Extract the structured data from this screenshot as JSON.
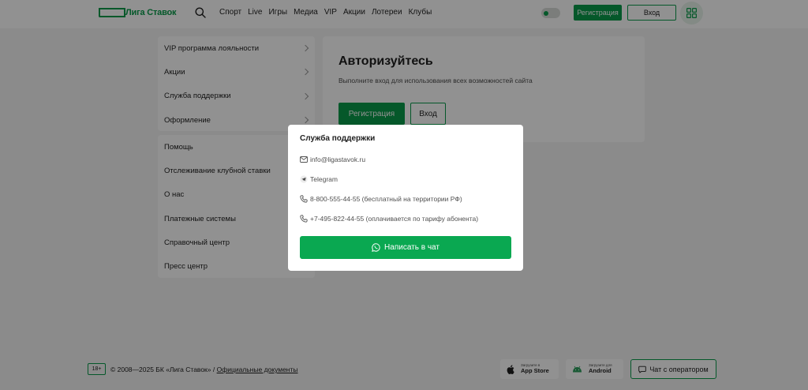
{
  "header": {
    "logo_text": "Лига Ставок",
    "nav": [
      "Спорт",
      "Live",
      "Игры",
      "Медиа",
      "VIP",
      "Акции",
      "Лотереи",
      "Клубы"
    ],
    "register_label": "Регистрация",
    "login_label": "Вход"
  },
  "sidebar": {
    "group1": [
      {
        "label": "VIP программа лояльности"
      },
      {
        "label": "Акции"
      },
      {
        "label": "Служба поддержки"
      },
      {
        "label": "Оформление"
      }
    ],
    "group2": [
      {
        "label": "Помощь"
      },
      {
        "label": "Отслеживание клубной ставки"
      },
      {
        "label": "О нас"
      },
      {
        "label": "Платежные системы"
      },
      {
        "label": "Справочный центр"
      },
      {
        "label": "Пресс центр"
      }
    ]
  },
  "main": {
    "title": "Авторизуйтесь",
    "subtitle": "Выполните вход для использования всех возможностей сайта",
    "register_label": "Регистрация",
    "login_label": "Вход"
  },
  "modal": {
    "title": "Служба поддержки",
    "email": "info@ligastavok.ru",
    "telegram": "Telegram",
    "phone1": "8-800-555-44-55 (бесплатный на территории РФ)",
    "phone2": "+7-495-822-44-55 (оплачивается по тарифу абонента)",
    "chat_label": "Написать в чат"
  },
  "footer": {
    "age": "18+",
    "copyright": "© 2008—2025 БК «Лига Ставок» / ",
    "docs_link": "Официальные документы",
    "appstore_small": "Загрузите в",
    "appstore_big": "App Store",
    "android_small": "Загрузите для",
    "android_big": "Android",
    "chat_operator": "Чат с оператором"
  },
  "colors": {
    "brand_green": "#0a9b4a",
    "chat_green": "#0aa851",
    "overlay": "rgba(0,0,0,0.43)"
  },
  "icons": [
    "search-icon",
    "grid-icon",
    "chevron-right-icon",
    "mail-icon",
    "telegram-icon",
    "phone-icon",
    "whatsapp-icon",
    "apple-icon",
    "android-icon",
    "chat-icon"
  ]
}
